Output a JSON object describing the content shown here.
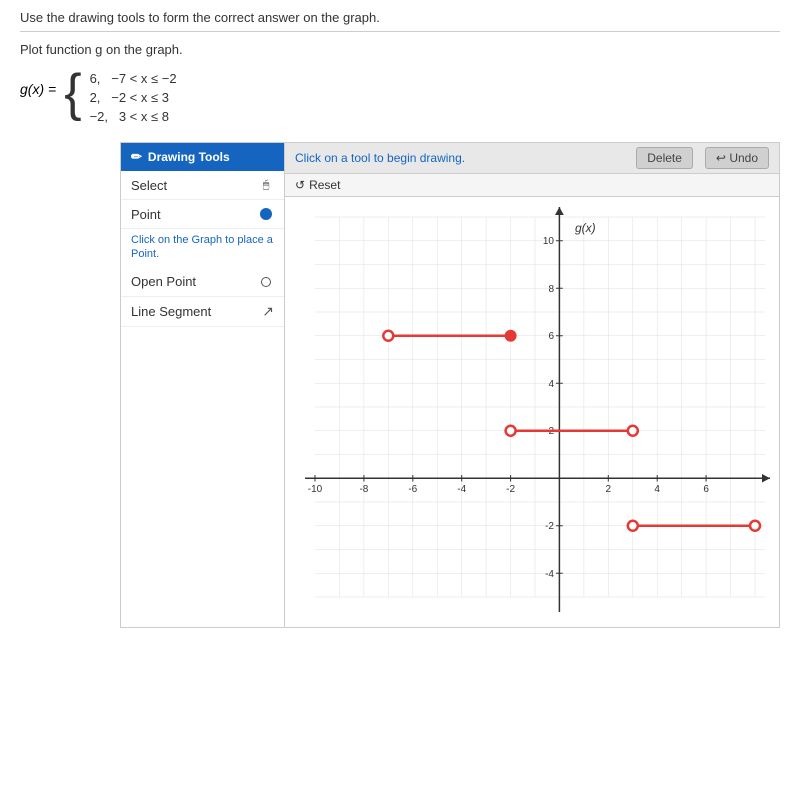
{
  "page": {
    "top_instruction": "Use the drawing tools to form the correct answer on the graph.",
    "problem_label": "Plot function g on the graph.",
    "piecewise_label": "g(x) =",
    "cases": [
      {
        "value": "6,",
        "condition": "−7 < x ≤ −2"
      },
      {
        "value": "2,",
        "condition": "−2 < x ≤ 3"
      },
      {
        "value": "−2,",
        "condition": "3 < x ≤ 8"
      }
    ]
  },
  "drawing_tools": {
    "header": "Drawing Tools",
    "hint": "Click on a tool to begin drawing.",
    "delete_label": "Delete",
    "undo_label": "Undo",
    "reset_label": "Reset",
    "tools": [
      {
        "name": "Select",
        "icon": "cursor"
      },
      {
        "name": "Point",
        "icon": "dot",
        "description": "Click on the Graph to place a Point."
      },
      {
        "name": "Open Point",
        "icon": "open-circle"
      },
      {
        "name": "Line Segment",
        "icon": "segment"
      }
    ]
  },
  "graph": {
    "x_label": "",
    "y_label": "g(x)",
    "x_min": -10,
    "x_max": 8,
    "y_min": -5,
    "y_max": 11,
    "x_ticks": [
      -10,
      -8,
      -6,
      -4,
      -2,
      2,
      4,
      6
    ],
    "y_ticks": [
      -4,
      -2,
      2,
      4,
      6,
      8,
      10
    ],
    "segments": [
      {
        "x1": -7,
        "y1": 6,
        "x2": -2,
        "y2": 6,
        "open_left": true,
        "closed_right": true,
        "color": "#e53935"
      },
      {
        "x1": -2,
        "y1": 2,
        "x2": 3,
        "y2": 2,
        "open_left": true,
        "closed_right": false,
        "color": "#e53935"
      },
      {
        "x1": 3,
        "y1": -2,
        "x2": 8,
        "y2": -2,
        "open_left": true,
        "closed_right": false,
        "color": "#e53935"
      }
    ]
  }
}
